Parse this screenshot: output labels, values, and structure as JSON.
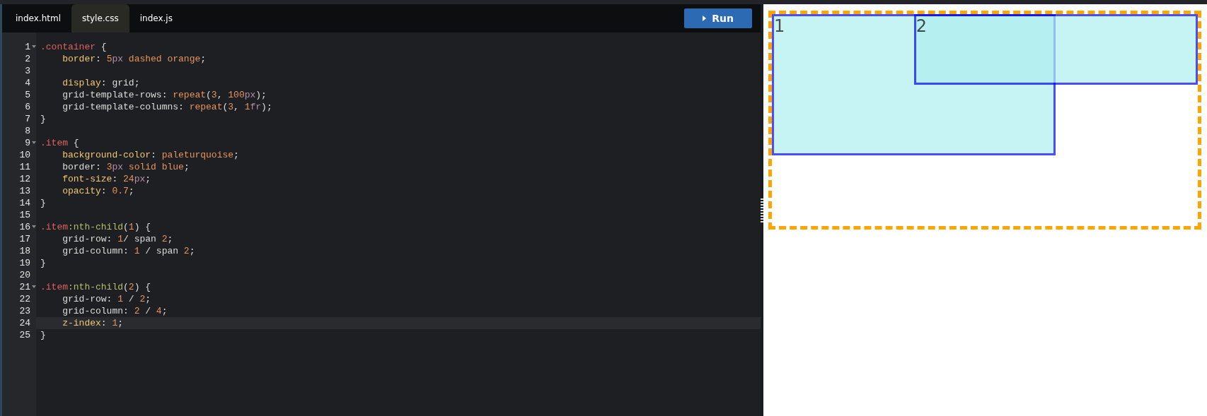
{
  "editor": {
    "tabs": [
      {
        "label": "index.html",
        "selected": false
      },
      {
        "label": "style.css",
        "selected": true
      },
      {
        "label": "index.js",
        "selected": false
      }
    ],
    "run_button": {
      "label": "Run"
    },
    "lines": [
      {
        "number": "1",
        "foldable": true,
        "current": false,
        "tokens": [
          {
            "kind": "sel",
            "text": ".container"
          },
          {
            "kind": "plain",
            "text": " {"
          }
        ]
      },
      {
        "number": "2",
        "foldable": false,
        "current": false,
        "tokens": [
          {
            "kind": "prop",
            "text": "    border"
          },
          {
            "kind": "plain",
            "text": ": "
          },
          {
            "kind": "num",
            "text": "5"
          },
          {
            "kind": "unit",
            "text": "px"
          },
          {
            "kind": "val",
            "text": " dashed orange"
          },
          {
            "kind": "plain",
            "text": ";"
          }
        ]
      },
      {
        "number": "3",
        "foldable": false,
        "current": false
      },
      {
        "number": "4",
        "foldable": false,
        "current": false,
        "tokens": [
          {
            "kind": "prop",
            "text": "    display"
          },
          {
            "kind": "plain",
            "text": ": grid;"
          }
        ]
      },
      {
        "number": "5",
        "foldable": false,
        "current": false,
        "tokens": [
          {
            "kind": "plain",
            "text": "    grid-template-rows: "
          },
          {
            "kind": "val",
            "text": "repeat"
          },
          {
            "kind": "plain",
            "text": "("
          },
          {
            "kind": "num",
            "text": "3"
          },
          {
            "kind": "plain",
            "text": ", "
          },
          {
            "kind": "num",
            "text": "100"
          },
          {
            "kind": "unit",
            "text": "px"
          },
          {
            "kind": "plain",
            "text": ");"
          }
        ]
      },
      {
        "number": "6",
        "foldable": false,
        "current": false,
        "tokens": [
          {
            "kind": "plain",
            "text": "    grid-template-columns: "
          },
          {
            "kind": "val",
            "text": "repeat"
          },
          {
            "kind": "plain",
            "text": "("
          },
          {
            "kind": "num",
            "text": "3"
          },
          {
            "kind": "plain",
            "text": ", "
          },
          {
            "kind": "num",
            "text": "1"
          },
          {
            "kind": "unit",
            "text": "fr"
          },
          {
            "kind": "plain",
            "text": ");"
          }
        ]
      },
      {
        "number": "7",
        "foldable": false,
        "current": false,
        "tokens": [
          {
            "kind": "plain",
            "text": "}"
          }
        ]
      },
      {
        "number": "8",
        "foldable": false,
        "current": false
      },
      {
        "number": "9",
        "foldable": true,
        "current": false,
        "tokens": [
          {
            "kind": "sel",
            "text": ".item"
          },
          {
            "kind": "plain",
            "text": " {"
          }
        ]
      },
      {
        "number": "10",
        "foldable": false,
        "current": false,
        "tokens": [
          {
            "kind": "prop",
            "text": "    background-color"
          },
          {
            "kind": "plain",
            "text": ": "
          },
          {
            "kind": "val",
            "text": "paleturquoise"
          },
          {
            "kind": "plain",
            "text": ";"
          }
        ]
      },
      {
        "number": "11",
        "foldable": false,
        "current": false,
        "tokens": [
          {
            "kind": "plain",
            "text": "    border: "
          },
          {
            "kind": "num",
            "text": "3"
          },
          {
            "kind": "unit",
            "text": "px"
          },
          {
            "kind": "val",
            "text": " solid blue"
          },
          {
            "kind": "plain",
            "text": ";"
          }
        ]
      },
      {
        "number": "12",
        "foldable": false,
        "current": false,
        "tokens": [
          {
            "kind": "prop",
            "text": "    font-size"
          },
          {
            "kind": "plain",
            "text": ": "
          },
          {
            "kind": "num",
            "text": "24"
          },
          {
            "kind": "unit",
            "text": "px"
          },
          {
            "kind": "plain",
            "text": ";"
          }
        ]
      },
      {
        "number": "13",
        "foldable": false,
        "current": false,
        "tokens": [
          {
            "kind": "prop",
            "text": "    opacity"
          },
          {
            "kind": "plain",
            "text": ": "
          },
          {
            "kind": "num",
            "text": "0.7"
          },
          {
            "kind": "plain",
            "text": ";"
          }
        ]
      },
      {
        "number": "14",
        "foldable": false,
        "current": false,
        "tokens": [
          {
            "kind": "plain",
            "text": "}"
          }
        ]
      },
      {
        "number": "15",
        "foldable": false,
        "current": false
      },
      {
        "number": "16",
        "foldable": true,
        "current": false,
        "tokens": [
          {
            "kind": "sel",
            "text": ".item"
          },
          {
            "kind": "pseudo",
            "text": ":nth-child"
          },
          {
            "kind": "plain",
            "text": "("
          },
          {
            "kind": "num",
            "text": "1"
          },
          {
            "kind": "plain",
            "text": ") {"
          }
        ]
      },
      {
        "number": "17",
        "foldable": false,
        "current": false,
        "tokens": [
          {
            "kind": "plain",
            "text": "    grid-row: "
          },
          {
            "kind": "num",
            "text": "1"
          },
          {
            "kind": "plain",
            "text": "/ span "
          },
          {
            "kind": "num",
            "text": "2"
          },
          {
            "kind": "plain",
            "text": ";"
          }
        ]
      },
      {
        "number": "18",
        "foldable": false,
        "current": false,
        "tokens": [
          {
            "kind": "plain",
            "text": "    grid-column: "
          },
          {
            "kind": "num",
            "text": "1"
          },
          {
            "kind": "plain",
            "text": " / span "
          },
          {
            "kind": "num",
            "text": "2"
          },
          {
            "kind": "plain",
            "text": ";"
          }
        ]
      },
      {
        "number": "19",
        "foldable": false,
        "current": false,
        "tokens": [
          {
            "kind": "plain",
            "text": "}"
          }
        ]
      },
      {
        "number": "20",
        "foldable": false,
        "current": false
      },
      {
        "number": "21",
        "foldable": true,
        "current": false,
        "tokens": [
          {
            "kind": "sel",
            "text": ".item"
          },
          {
            "kind": "pseudo",
            "text": ":nth-child"
          },
          {
            "kind": "plain",
            "text": "("
          },
          {
            "kind": "num",
            "text": "2"
          },
          {
            "kind": "plain",
            "text": ") {"
          }
        ]
      },
      {
        "number": "22",
        "foldable": false,
        "current": false,
        "tokens": [
          {
            "kind": "plain",
            "text": "    grid-row: "
          },
          {
            "kind": "num",
            "text": "1"
          },
          {
            "kind": "plain",
            "text": " / "
          },
          {
            "kind": "num",
            "text": "2"
          },
          {
            "kind": "plain",
            "text": ";"
          }
        ]
      },
      {
        "number": "23",
        "foldable": false,
        "current": false,
        "tokens": [
          {
            "kind": "plain",
            "text": "    grid-column: "
          },
          {
            "kind": "num",
            "text": "2"
          },
          {
            "kind": "plain",
            "text": " / "
          },
          {
            "kind": "num",
            "text": "4"
          },
          {
            "kind": "plain",
            "text": ";"
          }
        ]
      },
      {
        "number": "24",
        "foldable": false,
        "current": true,
        "tokens": [
          {
            "kind": "prop",
            "text": "    z-index"
          },
          {
            "kind": "plain",
            "text": ": "
          },
          {
            "kind": "num",
            "text": "1"
          },
          {
            "kind": "plain",
            "text": ";"
          }
        ]
      },
      {
        "number": "25",
        "foldable": false,
        "current": false,
        "tokens": [
          {
            "kind": "plain",
            "text": "}"
          }
        ]
      }
    ]
  },
  "preview": {
    "items": [
      {
        "label": "1"
      },
      {
        "label": "2"
      }
    ]
  }
}
